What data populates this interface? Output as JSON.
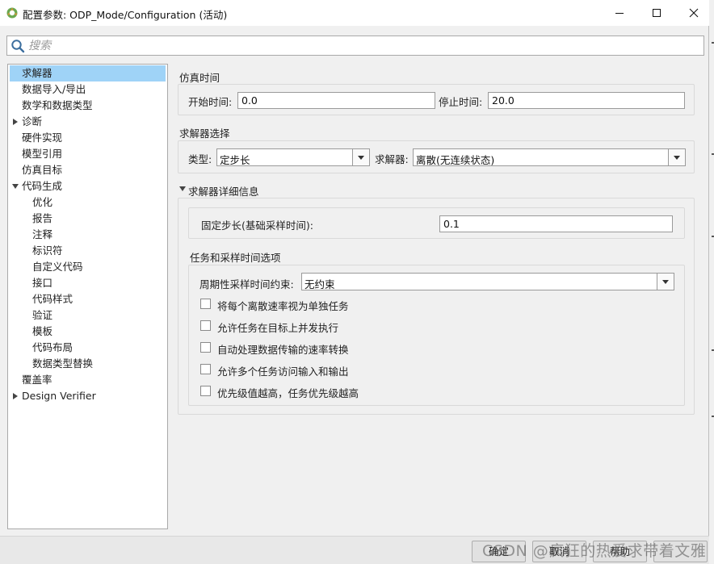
{
  "window": {
    "title": "配置参数: ODP_Mode/Configuration (活动)",
    "controls": {
      "minimize": "minimize",
      "maximize": "maximize",
      "close": "close"
    }
  },
  "search": {
    "placeholder": "搜索"
  },
  "tree": {
    "items": [
      {
        "label": "求解器",
        "level": 0,
        "selected": true,
        "expander": "none"
      },
      {
        "label": "数据导入/导出",
        "level": 0,
        "selected": false,
        "expander": "none"
      },
      {
        "label": "数学和数据类型",
        "level": 0,
        "selected": false,
        "expander": "none"
      },
      {
        "label": "诊断",
        "level": 0,
        "selected": false,
        "expander": "collapsed"
      },
      {
        "label": "硬件实现",
        "level": 0,
        "selected": false,
        "expander": "none"
      },
      {
        "label": "模型引用",
        "level": 0,
        "selected": false,
        "expander": "none"
      },
      {
        "label": "仿真目标",
        "level": 0,
        "selected": false,
        "expander": "none"
      },
      {
        "label": "代码生成",
        "level": 0,
        "selected": false,
        "expander": "expanded"
      },
      {
        "label": "优化",
        "level": 1,
        "selected": false,
        "expander": "none"
      },
      {
        "label": "报告",
        "level": 1,
        "selected": false,
        "expander": "none"
      },
      {
        "label": "注释",
        "level": 1,
        "selected": false,
        "expander": "none"
      },
      {
        "label": "标识符",
        "level": 1,
        "selected": false,
        "expander": "none"
      },
      {
        "label": "自定义代码",
        "level": 1,
        "selected": false,
        "expander": "none"
      },
      {
        "label": "接口",
        "level": 1,
        "selected": false,
        "expander": "none"
      },
      {
        "label": "代码样式",
        "level": 1,
        "selected": false,
        "expander": "none"
      },
      {
        "label": "验证",
        "level": 1,
        "selected": false,
        "expander": "none"
      },
      {
        "label": "模板",
        "level": 1,
        "selected": false,
        "expander": "none"
      },
      {
        "label": "代码布局",
        "level": 1,
        "selected": false,
        "expander": "none"
      },
      {
        "label": "数据类型替换",
        "level": 1,
        "selected": false,
        "expander": "none"
      },
      {
        "label": "覆盖率",
        "level": 0,
        "selected": false,
        "expander": "none"
      },
      {
        "label": "Design Verifier",
        "level": 0,
        "selected": false,
        "expander": "collapsed"
      }
    ]
  },
  "sim_time": {
    "section": "仿真时间",
    "start_label": "开始时间:",
    "start_value": "0.0",
    "stop_label": "停止时间:",
    "stop_value": "20.0"
  },
  "solver_select": {
    "section": "求解器选择",
    "type_label": "类型:",
    "type_value": "定步长",
    "solver_label": "求解器:",
    "solver_value": "离散(无连续状态)"
  },
  "solver_details": {
    "section": "求解器详细信息",
    "fixed_step_label": "固定步长(基础采样时间):",
    "fixed_step_value": "0.1",
    "tasking_section": "任务和采样时间选项",
    "periodic_label": "周期性采样时间约束:",
    "periodic_value": "无约束",
    "checkboxes": [
      {
        "label": "将每个离散速率视为单独任务",
        "checked": false
      },
      {
        "label": "允许任务在目标上并发执行",
        "checked": false
      },
      {
        "label": "自动处理数据传输的速率转换",
        "checked": false
      },
      {
        "label": "允许多个任务访问输入和输出",
        "checked": false
      },
      {
        "label": "优先级值越高，任务优先级越高",
        "checked": false
      }
    ]
  },
  "buttons": {
    "ok": "确定",
    "cancel": "取消",
    "help": "帮助"
  },
  "watermark": "CSDN @疯狂的热爱求带着文雅"
}
